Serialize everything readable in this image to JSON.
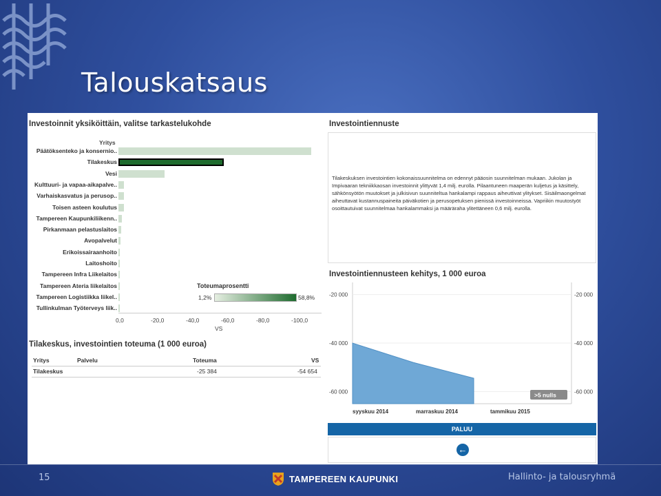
{
  "slide": {
    "title": "Talouskatsaus",
    "page_number": "15",
    "footer_org": "TAMPEREEN KAUPUNKI",
    "footer_right": "Hallinto- ja talousryhmä"
  },
  "dashboard": {
    "left_title": "Investoinnit yksiköittäin, valitse tarkastelukohde",
    "yritys_header": "Yritys",
    "units": [
      {
        "label": "Päätöksenteko ja konsernio..",
        "value": -100.0
      },
      {
        "label": "Tilakeskus",
        "value": -54.6,
        "selected": true
      },
      {
        "label": "Vesi",
        "value": -24.0
      },
      {
        "label": "Kulttuuri- ja vapaa-aikapalve..",
        "value": -3.0
      },
      {
        "label": "Varhaiskasvatus ja perusop..",
        "value": -3.0
      },
      {
        "label": "Toisen asteen koulutus",
        "value": -2.8
      },
      {
        "label": "Tampereen Kaupunkiliikenn..",
        "value": -1.8
      },
      {
        "label": "Pirkanmaan pelastuslaitos",
        "value": -1.3
      },
      {
        "label": "Avopalvelut",
        "value": -1.0
      },
      {
        "label": "Erikoissairaanhoito",
        "value": -0.8
      },
      {
        "label": "Laitoshoito",
        "value": -0.6
      },
      {
        "label": "Tampereen Infra Liikelaitos",
        "value": -0.5
      },
      {
        "label": "Tampereen Ateria liikelaitos",
        "value": -0.4
      },
      {
        "label": "Tampereen Logistiikka liikel..",
        "value": -0.3
      },
      {
        "label": "Tullinkulman Työterveys liik..",
        "value": -0.2
      }
    ],
    "x_ticks": [
      "0,0",
      "-20,0",
      "-40,0",
      "-60,0",
      "-80,0",
      "-100,0"
    ],
    "x_axis_label": "VS",
    "legend": {
      "title": "Toteumaprosentti",
      "min": "1,2%",
      "max": "58,8%"
    },
    "table_title": "Tilakeskus, investointien toteuma (1 000 euroa)",
    "table_headers": {
      "yritys": "Yritys",
      "palvelu": "Palvelu",
      "toteuma": "Toteuma",
      "vs": "VS"
    },
    "table_rows": [
      {
        "yritys": "Tilakeskus",
        "palvelu": "",
        "toteuma": "-25 384",
        "vs": "-54 654"
      }
    ],
    "forecast_title": "Investointiennuste",
    "forecast_text": "Tilakeskuksen investointien kokonaissuunnitelma on edennyt pääosin suunnitelman mukaan. Jukolan ja Impivaaran tekniikkaosan investoinnit ylittyvät 1,4 milj. eurolla. Pilaantuneen maaperän kuljetus ja käsittely, sähkönsyötön muutokset ja julkisivun suunniteltua hankalampi rappaus aiheuttivat ylitykset. Sisäilmaongelmat aiheuttavat kustannuspaineita päiväkotien ja perusopetuksen pienissä investoinneissa. Vapriikin muutostyöt osoittautuivat suunnitelmaa hankalammaksi ja määräraha ylitettäneen 0,6 milj. eurolla.",
    "chart_title": "Investointiennusteen kehitys, 1 000 euroa",
    "nulls_badge": ">5 nulls",
    "paluu_label": "PALUU"
  },
  "chart_data": {
    "type": "area",
    "title": "Investointiennusteen kehitys, 1 000 euroa",
    "x": [
      "syyskuu 2014",
      "marraskuu 2014",
      "tammikuu 2015"
    ],
    "y_ticks": [
      "-60 000",
      "-40 000",
      "-20 000"
    ],
    "ylim": [
      -15000,
      -65000
    ],
    "series": [
      {
        "values": [
          -40000,
          -48000,
          -54500
        ]
      }
    ],
    "area_color": "#6fa8d6"
  }
}
